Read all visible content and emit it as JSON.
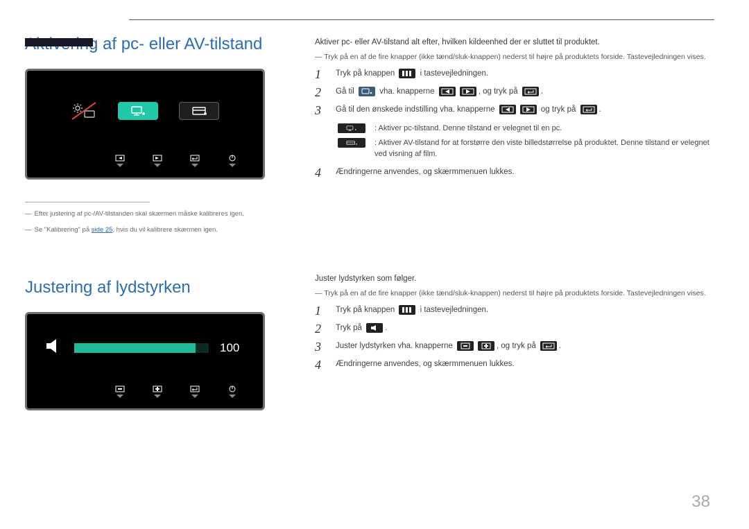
{
  "page_number": "38",
  "section1": {
    "title": "Aktivering af pc- eller AV-tilstand",
    "intro1": "Aktiver pc- eller AV-tilstand alt efter, hvilken kildeenhed der er sluttet til produktet.",
    "intro2": "Tryk på en af de fire knapper (ikke tænd/sluk-knappen) nederst til højre på produktets forside. Tastevejledningen vises.",
    "foot1": "Efter justering af pc-/AV-tilstanden skal skærmen måske kalibreres igen.",
    "foot2a": "Se \"Kalibrering\" på ",
    "foot2_link": "side 25",
    "foot2b": ", hvis du vil kalibrere skærmen igen.",
    "step1a": "Tryk på knappen ",
    "step1b": " i tastevejledningen.",
    "step2a": "Gå til ",
    "step2b": " vha. knapperne ",
    "step2c": ", og tryk på ",
    "step2d": ".",
    "step3a": "Gå til den ønskede indstilling vha. knapperne ",
    "step3b": " og tryk på ",
    "step3c": ".",
    "sub_pc": ": Aktiver pc-tilstand. Denne tilstand er velegnet til en pc.",
    "sub_av": ": Aktiver AV-tilstand for at forstørre den viste billedstørrelse på produktet. Denne tilstand er velegnet ved visning af film.",
    "step4": "Ændringerne anvendes, og skærmmenuen lukkes."
  },
  "section2": {
    "title": "Justering af lydstyrken",
    "intro1": "Juster lydstyrken som følger.",
    "intro2": "Tryk på en af de fire knapper (ikke tænd/sluk-knappen) nederst til højre på produktets forside. Tastevejledningen vises.",
    "volume_value": "100",
    "step1a": "Tryk på knappen ",
    "step1b": " i tastevejledningen.",
    "step2a": "Tryk på ",
    "step2b": ".",
    "step3a": "Juster lydstyrken vha. knapperne ",
    "step3b": ", og tryk på ",
    "step3c": ".",
    "step4": "Ændringerne anvendes, og skærmmenuen lukkes."
  },
  "nums": {
    "n1": "1",
    "n2": "2",
    "n3": "3",
    "n4": "4"
  }
}
